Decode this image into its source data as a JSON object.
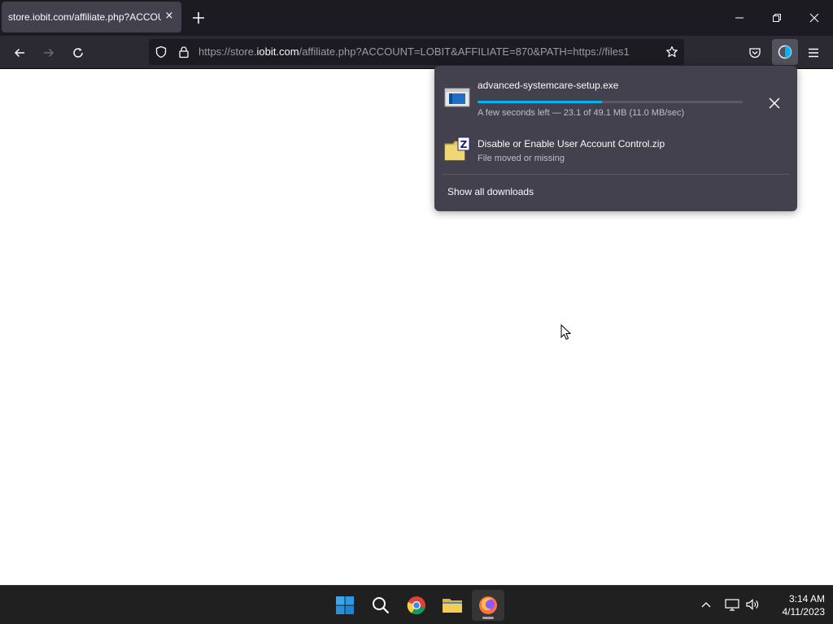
{
  "tab": {
    "title": "store.iobit.com/affiliate.php?ACCOUNT",
    "close_glyph": "×"
  },
  "urlbar": {
    "prefix": "https://store.",
    "host": "iobit.com",
    "suffix": "/affiliate.php?ACCOUNT=LOBIT&AFFILIATE=870&PATH=https://files1"
  },
  "downloads": {
    "items": [
      {
        "name": "advanced-systemcare-setup.exe",
        "status": "A few seconds left — 23.1 of 49.1 MB (11.0 MB/sec)",
        "progress": 0.47,
        "icon": "exe-file-icon"
      },
      {
        "name": "Disable or Enable User Account Control.zip",
        "status": "File moved or missing",
        "icon": "zip-file-icon"
      }
    ],
    "show_all_label": "Show all downloads"
  },
  "taskbar": {
    "apps": [
      "windows-start-icon",
      "search-icon",
      "chrome-icon",
      "file-explorer-icon",
      "firefox-icon"
    ],
    "clock": {
      "time": "3:14 AM",
      "date": "4/11/2023"
    }
  },
  "colors": {
    "chrome_dark": "#1c1b22",
    "toolbar": "#2b2a33",
    "panel": "#42414d",
    "accent": "#00b3f4",
    "taskbar": "#202020"
  }
}
